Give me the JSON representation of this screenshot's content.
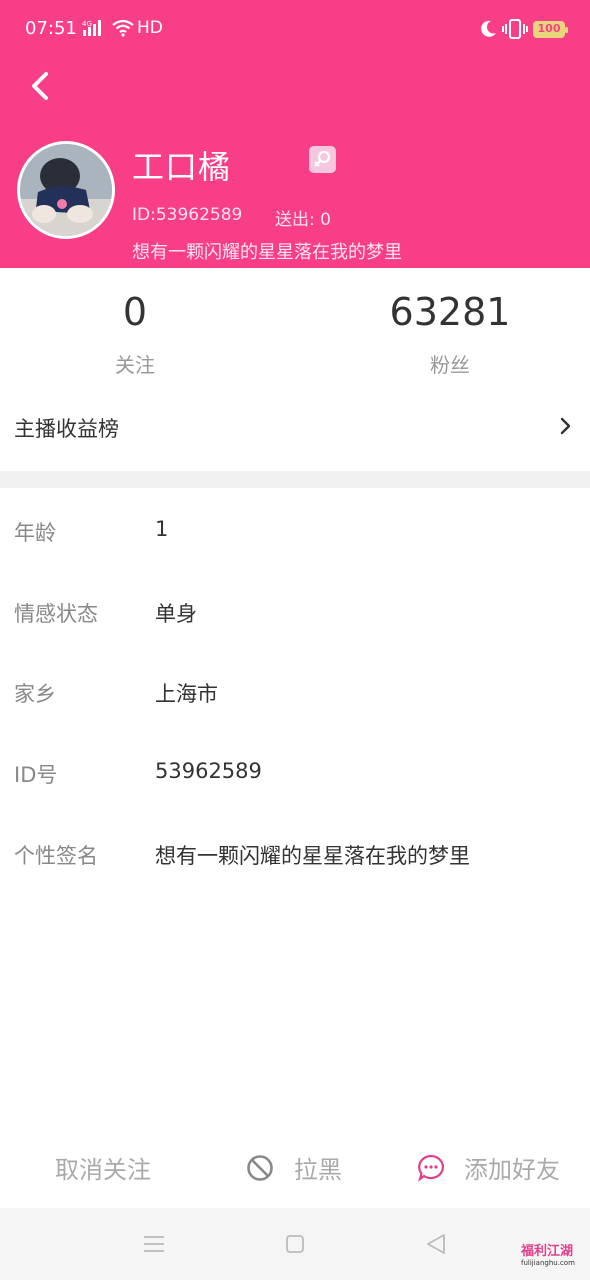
{
  "status_bar": {
    "time": "07:51",
    "network_label": "HD",
    "battery": "100"
  },
  "profile": {
    "nickname": "工口橘",
    "id_text": "ID:53962589",
    "sent_text": "送出: 0",
    "signature": "想有一颗闪耀的星星落在我的梦里",
    "gender_icon": "female-icon"
  },
  "stats": {
    "following_count": "0",
    "following_label": "关注",
    "fans_count": "63281",
    "fans_label": "粉丝"
  },
  "rank": {
    "label": "主播收益榜"
  },
  "info": [
    {
      "key": "年龄",
      "value": "1"
    },
    {
      "key": "情感状态",
      "value": "单身"
    },
    {
      "key": "家乡",
      "value": "上海市"
    },
    {
      "key": "ID号",
      "value": "53962589"
    },
    {
      "key": "个性签名",
      "value": "想有一颗闪耀的星星落在我的梦里"
    }
  ],
  "actions": {
    "unfollow": "取消关注",
    "block": "拉黑",
    "add_friend": "添加好友"
  },
  "watermark": {
    "brand": "福利江湖",
    "site": "fulijianghu.com"
  },
  "colors": {
    "header_bg": "#f93e88",
    "divider": "#f0f0f0",
    "chat_icon": "#e0408a"
  }
}
